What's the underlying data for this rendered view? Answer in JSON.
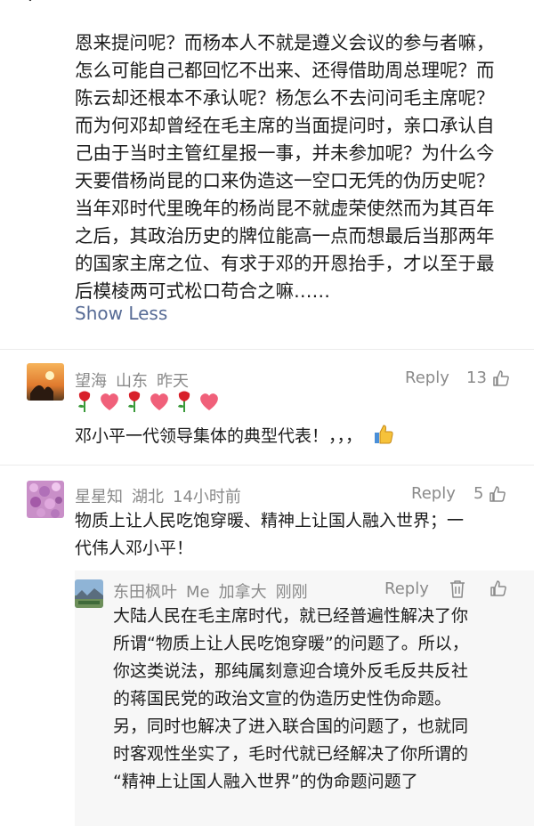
{
  "post": {
    "paragraph_lines": [
      "恩来提问呢？而杨本人不就是遵义会议的参与者嘛，",
      "怎么可能自己都回忆不出来、还得借助周总理呢？而",
      "陈云却还根本不承认呢？杨怎么不去问问毛主席呢？",
      "而为何邓却曾经在毛主席的当面提问时，亲口承认自",
      "己由于当时主管红星报一事，并未参加呢？为什么今",
      "天要借杨尚昆的口来伪造这一空口无凭的伪历史呢？",
      "当年邓时代里晚年的杨尚昆不就虚荣使然而为其百年",
      "之后，其政治历史的牌位能高一点而想最后当那两年",
      "的国家主席之位、有求于邓的开恩抬手，才以至于最",
      "后模棱两可式松口苟合之嘛……"
    ],
    "show_less": "Show Less"
  },
  "comments": [
    {
      "author": "望海",
      "location": "山东",
      "time": "昨天",
      "reply_label": "Reply",
      "likes": "13",
      "emoji_icons": [
        "rose-icon",
        "heart-icon",
        "rose-icon",
        "heart-icon",
        "rose-icon",
        "heart-icon"
      ],
      "text_lines": [
        "邓小平一代领导集体的典型代表！，，，"
      ]
    },
    {
      "author": "星星知",
      "location": "湖北",
      "time": "14小时前",
      "reply_label": "Reply",
      "likes": "5",
      "text_lines": [
        "物质上让人民吃饱穿暖、精神上让国人融入世界；一",
        "代伟人邓小平！"
      ]
    }
  ],
  "reply": {
    "author": "东田枫叶",
    "me_tag": "Me",
    "location": "加拿大",
    "time": "刚刚",
    "reply_label": "Reply",
    "text_lines": [
      "大陆人民在毛主席时代，就已经普遍性解决了你",
      "所谓“物质上让人民吃饱穿暖”的问题了。所以，",
      "你这类说法，那纯属刻意迎合境外反毛反共反社",
      "的蒋国民党的政治文宣的伪造历史性伪命题。",
      "另，同时也解决了进入联合国的问题了，也就同",
      "时客观性坐实了，毛时代就已经解决了你所谓的",
      "“精神上让国人融入世界”的伪命题问题了"
    ]
  },
  "colors": {
    "link": "#576b95",
    "meta": "#8a8a8a",
    "divider": "#ececec"
  }
}
